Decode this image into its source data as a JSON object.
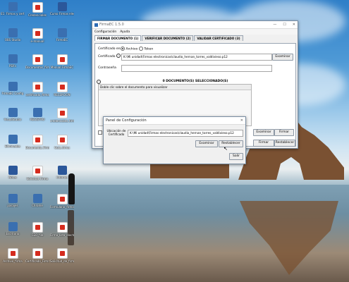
{
  "desktop": {
    "icons": [
      {
        "label": "E1: Firmas y cert.",
        "type": "app"
      },
      {
        "label": "Credenciales",
        "type": "pdf"
      },
      {
        "label": "Curso Firmas electrónicas",
        "type": "doc"
      },
      {
        "label": "OBS Studio",
        "type": "app"
      },
      {
        "label": "e-manual",
        "type": "pdf"
      },
      {
        "label": "FirmaEC",
        "type": "app"
      },
      {
        "label": "PDFs",
        "type": "app"
      },
      {
        "label": "Documentos_firmados",
        "type": "pdf"
      },
      {
        "label": "Manual FirmaEC",
        "type": "pdf"
      },
      {
        "label": "FirmaEC Config",
        "type": "app"
      },
      {
        "label": "certificado_firma",
        "type": "pdf"
      },
      {
        "label": "RECEPCIÓN",
        "type": "pdf"
      },
      {
        "label": "VisualStudio",
        "type": "app"
      },
      {
        "label": "REGISTRO",
        "type": "app"
      },
      {
        "label": "credenciales_firmado",
        "type": "pdf"
      },
      {
        "label": "Eliminados",
        "type": "app"
      },
      {
        "label": "Documento_Firma",
        "type": "pdf"
      },
      {
        "label": "Guía_firma",
        "type": "pdf"
      },
      {
        "label": "Notas",
        "type": "doc"
      },
      {
        "label": "Solicitud_Firma",
        "type": "pdf"
      },
      {
        "label": "Informe",
        "type": "doc"
      },
      {
        "label": "pasajes",
        "type": "app"
      },
      {
        "label": "Chrome",
        "type": "app"
      },
      {
        "label": "Formulario_firmado",
        "type": "pdf"
      },
      {
        "label": "Escritorio",
        "type": "app"
      },
      {
        "label": "CEO_file",
        "type": "pdf"
      },
      {
        "label": "Firma_lista_electronica",
        "type": "pdf"
      },
      {
        "label": "Archivo_firma",
        "type": "pdf"
      },
      {
        "label": "Certificado_Firma",
        "type": "pdf"
      },
      {
        "label": "Solicitud_de_firma",
        "type": "pdf"
      }
    ]
  },
  "main_window": {
    "title": "FirmaEC 1.5.0",
    "menu": [
      "Configuración",
      "Ayuda"
    ],
    "tabs": [
      "FIRMAR DOCUMENTO (1)",
      "VERIFICAR DOCUMENTO (2)",
      "VALIDAR CERTIFICADO (3)"
    ],
    "cert_label": "Certificado en",
    "radio_archivo": "Archivo",
    "radio_token": "Token",
    "certificado_label": "Certificado",
    "certificado_value": "K:\\Mi unidad\\Firmas electronicas\\claudio_hernan_torres_valdivieso.p12",
    "examinar": "Examinar",
    "contrasena_label": "Contraseña",
    "docs_header": "0 DOCUMENTO(S) SELECCIONADO(S)",
    "docs_hint": "Doble clic sobre el documento para visualizar",
    "btn_examinar2": "Examinar",
    "btn_firmar": "Firmar",
    "btn_firmar_right": "Firmar",
    "btn_restablecer": "Restablecer"
  },
  "dialog": {
    "title": "Panel de Configuración",
    "ubicacion_label": "Ubicación de Certificado",
    "ubicacion_value": "K:\\Mi unidad\\Firmas electronicas\\claudio_hernan_torres_valdivieso.p12",
    "examinar": "Examinar",
    "restablecer": "Restablecer",
    "salir": "Salir"
  }
}
